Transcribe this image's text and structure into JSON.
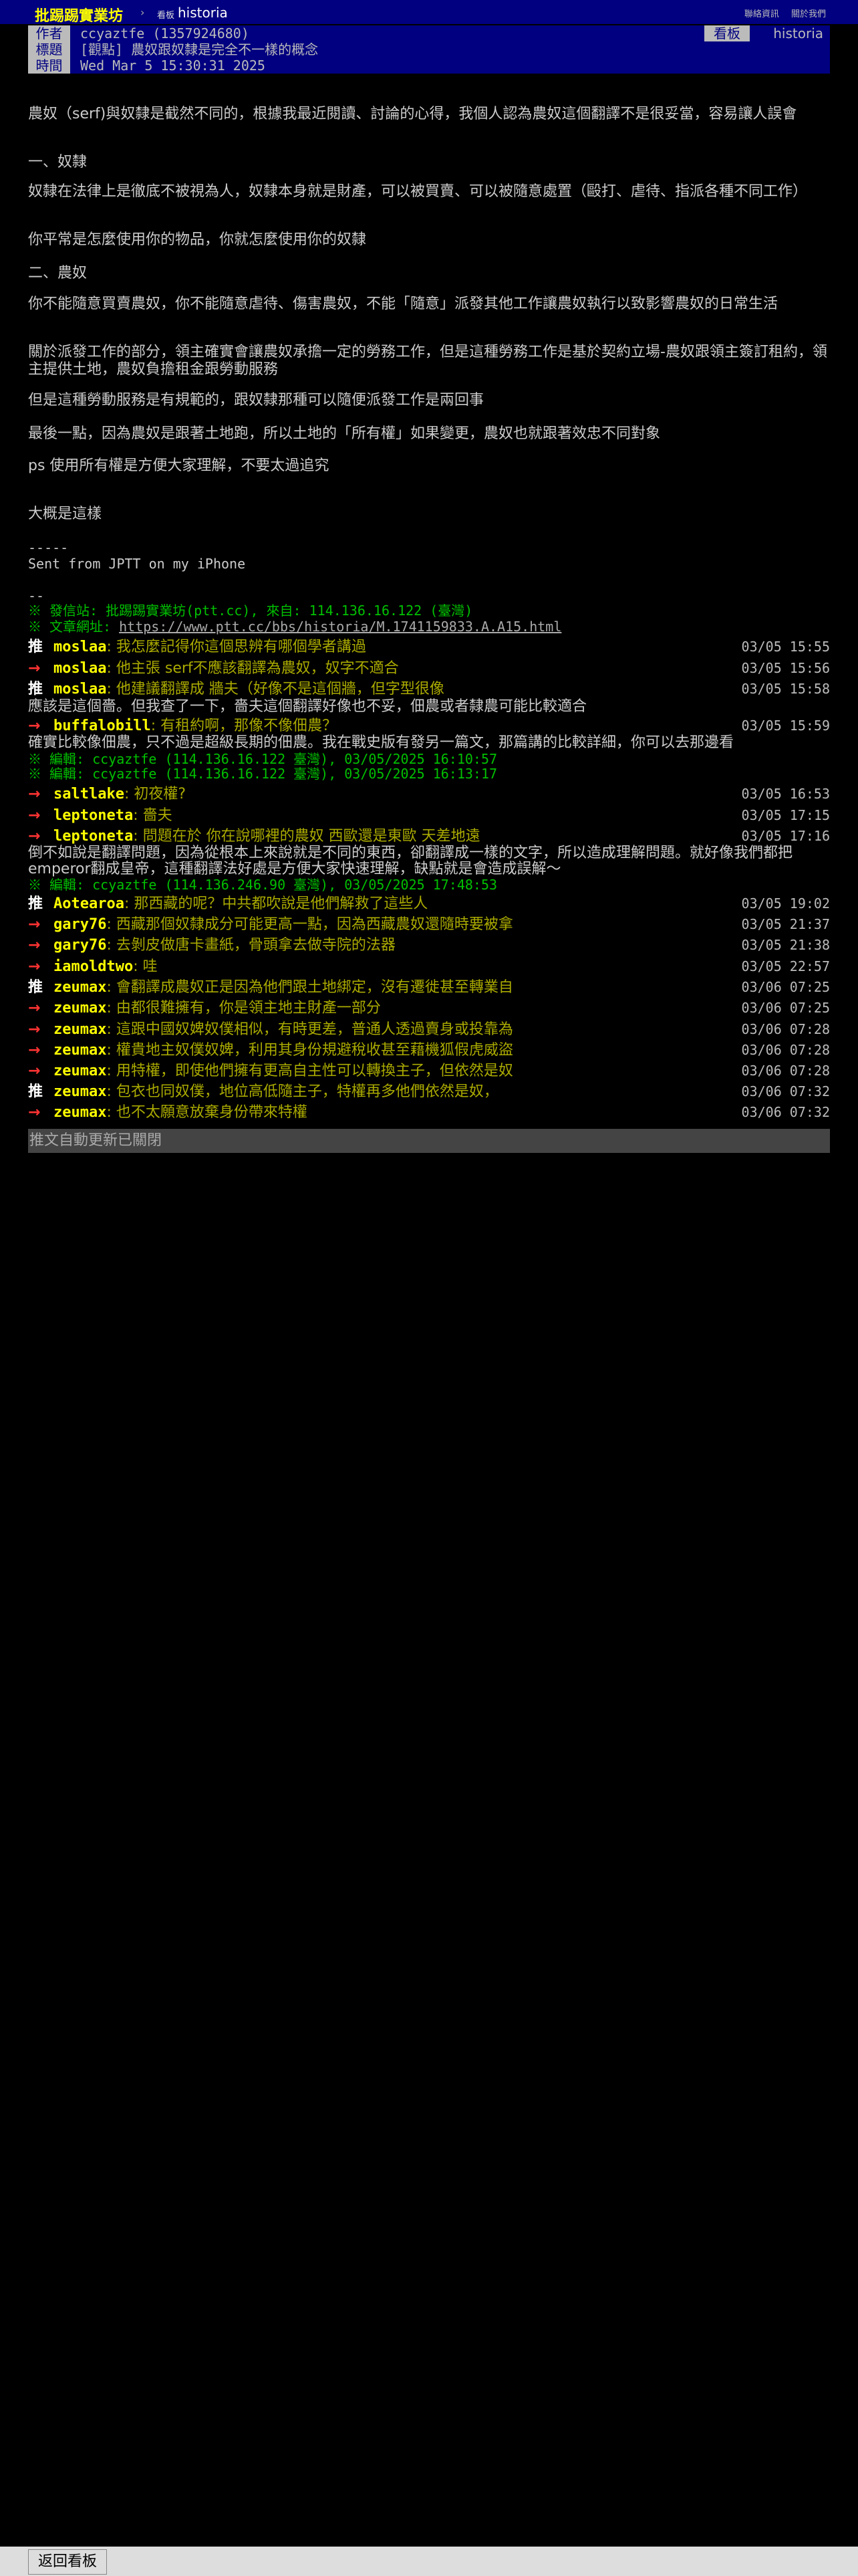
{
  "topbar": {
    "site": "批踢踢實業坊",
    "sep": "›",
    "board_tag": "看板",
    "board": "historia",
    "link1": "聯絡資訊",
    "link2": "關於我們"
  },
  "meta": {
    "author_tag": "作者",
    "author": "ccyaztfe (1357924680)",
    "title_tag": "標題",
    "title": "[觀點] 農奴跟奴隸是完全不一樣的概念",
    "time_tag": "時間",
    "time": "Wed Mar  5 15:30:31 2025",
    "board_tag": "看板",
    "board": "historia"
  },
  "body": {
    "p1": "農奴（serf)與奴隸是截然不同的，根據我最近閱讀、討論的心得，我個人認為農奴這個翻譯不是很妥當，容易讓人誤會",
    "h1": "一、奴隸",
    "p2": "奴隸在法律上是徹底不被視為人，奴隸本身就是財產，可以被買賣、可以被隨意處置（毆打、虐待、指派各種不同工作）",
    "p3": "你平常是怎麼使用你的物品，你就怎麼使用你的奴隸",
    "h2": "二、農奴",
    "p4": "你不能隨意買賣農奴，你不能隨意虐待、傷害農奴，不能「隨意」派發其他工作讓農奴執行以致影響農奴的日常生活",
    "p5": "關於派發工作的部分，領主確實會讓農奴承擔一定的勞務工作，但是這種勞務工作是基於契約立場-農奴跟領主簽訂租約，領主提供土地，農奴負擔租金跟勞動服務",
    "p6": "但是這種勞動服務是有規範的，跟奴隸那種可以隨便派發工作是兩回事",
    "p7": "最後一點，因為農奴是跟著土地跑，所以土地的「所有權」如果變更，農奴也就跟著效忠不同對象",
    "p8": "ps 使用所有權是方便大家理解，不要太過追究",
    "p9": "大概是這樣",
    "sig1": "-----",
    "sig2": "Sent from JPTT on my iPhone",
    "dash": "--",
    "src1": "※ 發信站: 批踢踢實業坊(ptt.cc), 來自: 114.136.16.122 (臺灣)",
    "src2_prefix": "※ 文章網址: ",
    "src2_url": "https://www.ptt.cc/bbs/historia/M.1741159833.A.A15.html"
  },
  "pushes": [
    {
      "tag": "推",
      "user": "moslaa",
      "msg": ": 我怎麼記得你這個思辨有哪個學者講過",
      "time": "03/05 15:55"
    },
    {
      "tag": "→",
      "user": "moslaa",
      "msg": ": 他主張 serf不應該翻譯為農奴，奴字不適合",
      "time": "03/05 15:56"
    },
    {
      "tag": "推",
      "user": "moslaa",
      "msg": ": 他建議翻譯成 牆夫（好像不是這個牆，但字型很像",
      "time": "03/05 15:58"
    },
    {
      "tag": "→",
      "user": "buffalobill",
      "msg": ": 有租約啊，那像不像佃農？",
      "time": "03/05 15:59"
    },
    {
      "tag": "→",
      "user": "saltlake",
      "msg": ": 初夜權?",
      "time": "03/05 16:53"
    },
    {
      "tag": "→",
      "user": "leptoneta",
      "msg": ": 嗇夫",
      "time": "03/05 17:15"
    },
    {
      "tag": "→",
      "user": "leptoneta",
      "msg": ": 問題在於 你在說哪裡的農奴 西歐還是東歐 天差地遠",
      "time": "03/05 17:16"
    },
    {
      "tag": "推",
      "user": "Aotearoa",
      "msg": ": 那西藏的呢？中共都吹說是他們解救了這些人",
      "time": "03/05 19:02"
    },
    {
      "tag": "→",
      "user": "gary76",
      "msg": ": 西藏那個奴隸成分可能更高一點，因為西藏農奴還隨時要被拿",
      "time": "03/05 21:37"
    },
    {
      "tag": "→",
      "user": "gary76",
      "msg": ": 去剝皮做唐卡畫紙，骨頭拿去做寺院的法器",
      "time": "03/05 21:38"
    },
    {
      "tag": "→",
      "user": "iamoldtwo",
      "msg": ": 哇",
      "time": "03/05 22:57"
    },
    {
      "tag": "推",
      "user": "zeumax",
      "msg": ": 會翻譯成農奴正是因為他們跟土地綁定，沒有遷徙甚至轉業自",
      "time": "03/06 07:25"
    },
    {
      "tag": "→",
      "user": "zeumax",
      "msg": ": 由都很難擁有，你是領主地主財產一部分",
      "time": "03/06 07:25"
    },
    {
      "tag": "→",
      "user": "zeumax",
      "msg": ": 這跟中國奴婢奴僕相似，有時更差，普通人透過賣身或投靠為",
      "time": "03/06 07:28"
    },
    {
      "tag": "→",
      "user": "zeumax",
      "msg": ": 權貴地主奴僕奴婢，利用其身份規避稅收甚至藉機狐假虎威盜",
      "time": "03/06 07:28"
    },
    {
      "tag": "→",
      "user": "zeumax",
      "msg": ": 用特權，即使他們擁有更高自主性可以轉換主子，但依然是奴",
      "time": "03/06 07:28"
    },
    {
      "tag": "推",
      "user": "zeumax",
      "msg": ": 包衣也同奴僕，地位高低隨主子，特權再多他們依然是奴，",
      "time": "03/06 07:32"
    },
    {
      "tag": "→",
      "user": "zeumax",
      "msg": ": 也不太願意放棄身份帶來特權",
      "time": "03/06 07:32"
    }
  ],
  "inline": {
    "after3": "應該是這個嗇。但我查了一下，嗇夫這個翻譯好像也不妥，佃農或者隸農可能比較適合",
    "after4": "確實比較像佃農，只不過是超級長期的佃農。我在戰史版有發另一篇文，那篇講的比較詳細，你可以去那邊看",
    "edit1": "※ 編輯: ccyaztfe (114.136.16.122 臺灣), 03/05/2025 16:10:57",
    "edit2": "※ 編輯: ccyaztfe (114.136.16.122 臺灣), 03/05/2025 16:13:17",
    "after7a": "倒不如說是翻譯問題，因為從根本上來說就是不同的東西，卻翻譯成一樣的文字，所以造成理解問題。就好像我們都把emperor翻成皇帝，這種翻譯法好處是方便大家快速理解，缺點就是會造成誤解～",
    "edit3": "※ 編輯: ccyaztfe (114.136.246.90 臺灣), 03/05/2025 17:48:53"
  },
  "status": "推文自動更新已關閉",
  "footer": {
    "back": "返回看板"
  }
}
